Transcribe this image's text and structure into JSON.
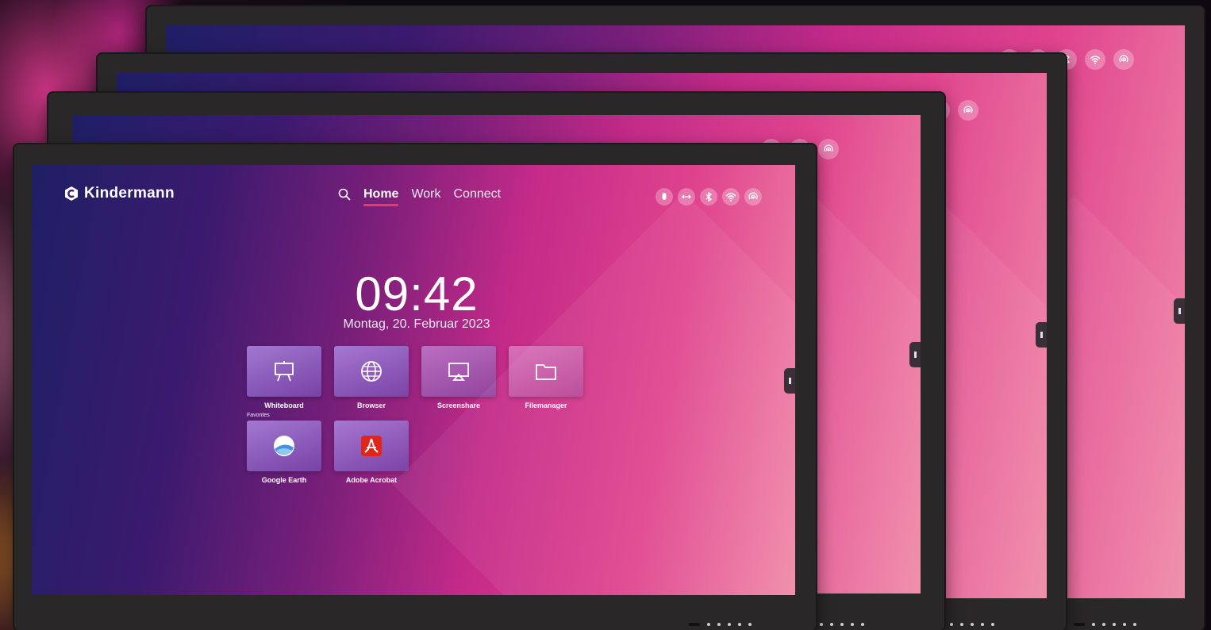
{
  "brand": {
    "name": "Kindermann"
  },
  "nav": {
    "tabs": [
      {
        "label": "Home",
        "active": true
      },
      {
        "label": "Work",
        "active": false
      },
      {
        "label": "Connect",
        "active": false
      }
    ]
  },
  "status_icons": [
    "mouse-icon",
    "input-switch-icon",
    "bluetooth-icon",
    "wifi-icon",
    "hotspot-icon"
  ],
  "clock": {
    "time": "09:42",
    "date": "Montag, 20. Februar 2023"
  },
  "apps": [
    {
      "label": "Whiteboard",
      "icon": "easel-icon"
    },
    {
      "label": "Browser",
      "icon": "globe-icon"
    },
    {
      "label": "Screenshare",
      "icon": "cast-screen-icon"
    },
    {
      "label": "Filemanager",
      "icon": "folder-icon"
    }
  ],
  "favorites": {
    "label": "Favorites",
    "items": [
      {
        "label": "Google Earth",
        "icon": "google-earth-icon"
      },
      {
        "label": "Adobe Acrobat",
        "icon": "adobe-acrobat-icon"
      }
    ]
  },
  "colors": {
    "accent": "#e23c6c",
    "screen_start": "#1f1f66",
    "screen_end": "#f08aa8"
  }
}
